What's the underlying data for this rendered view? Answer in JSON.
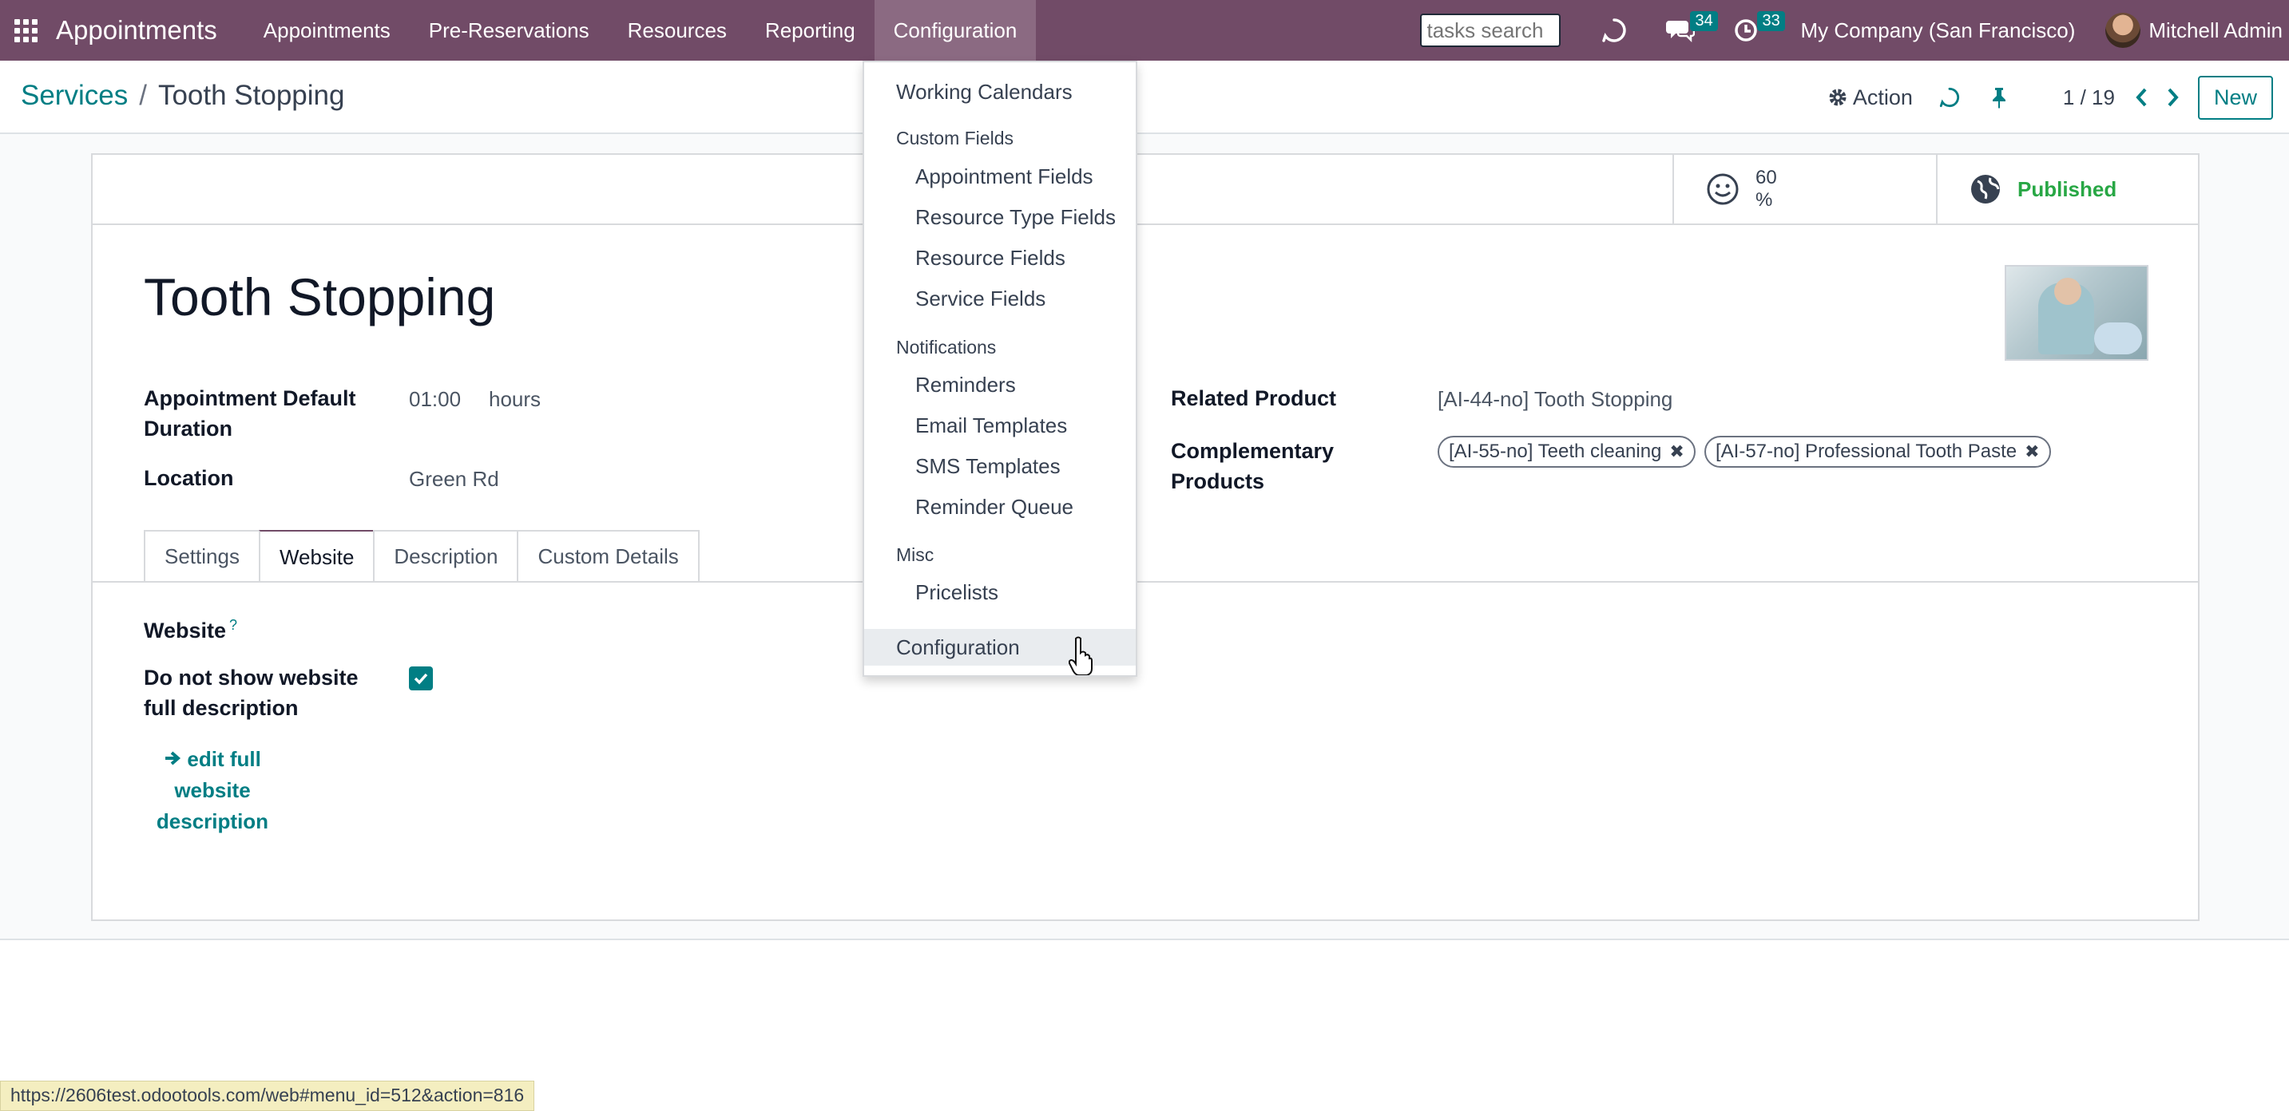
{
  "navbar": {
    "brand": "Appointments",
    "menu": [
      "Appointments",
      "Pre-Reservations",
      "Resources",
      "Reporting",
      "Configuration"
    ],
    "search_placeholder": "tasks search",
    "messages_count": "34",
    "activities_count": "33",
    "company": "My Company (San Francisco)",
    "user": "Mitchell Admin"
  },
  "control": {
    "breadcrumb_parent": "Services",
    "breadcrumb_sep": "/",
    "breadcrumb_current": "Tooth Stopping",
    "action_label": "Action",
    "pager": "1 / 19",
    "new_label": "New"
  },
  "stats": {
    "rating_value": "60",
    "rating_unit": "%",
    "published_label": "Published"
  },
  "form": {
    "title": "Tooth Stopping",
    "duration_label": "Appointment Default Duration",
    "duration_value": "01:00",
    "duration_unit": "hours",
    "location_label": "Location",
    "location_value": "Green Rd",
    "related_product_label": "Related Product",
    "related_product_value": "[AI-44-no] Tooth Stopping",
    "complementary_label": "Complementary Products",
    "complementary_tags": [
      "[AI-55-no] Teeth cleaning",
      "[AI-57-no] Professional Tooth Paste"
    ]
  },
  "tabs": [
    "Settings",
    "Website",
    "Description",
    "Custom Details"
  ],
  "website_tab": {
    "website_label": "Website",
    "help_mark": "?",
    "no_full_desc_label": "Do not show website full description",
    "no_full_desc_checked": true,
    "edit_link": "edit full website description"
  },
  "dropdown": {
    "working_calendars": "Working Calendars",
    "custom_fields_header": "Custom Fields",
    "custom_fields": [
      "Appointment Fields",
      "Resource Type Fields",
      "Resource Fields",
      "Service Fields"
    ],
    "notifications_header": "Notifications",
    "notifications": [
      "Reminders",
      "Email Templates",
      "SMS Templates",
      "Reminder Queue"
    ],
    "misc_header": "Misc",
    "misc": [
      "Pricelists"
    ],
    "configuration": "Configuration"
  },
  "status_url": "https://2606test.odootools.com/web#menu_id=512&action=816",
  "colors": {
    "navbar": "#714b67",
    "accent": "#017e84",
    "published": "#28a745"
  }
}
